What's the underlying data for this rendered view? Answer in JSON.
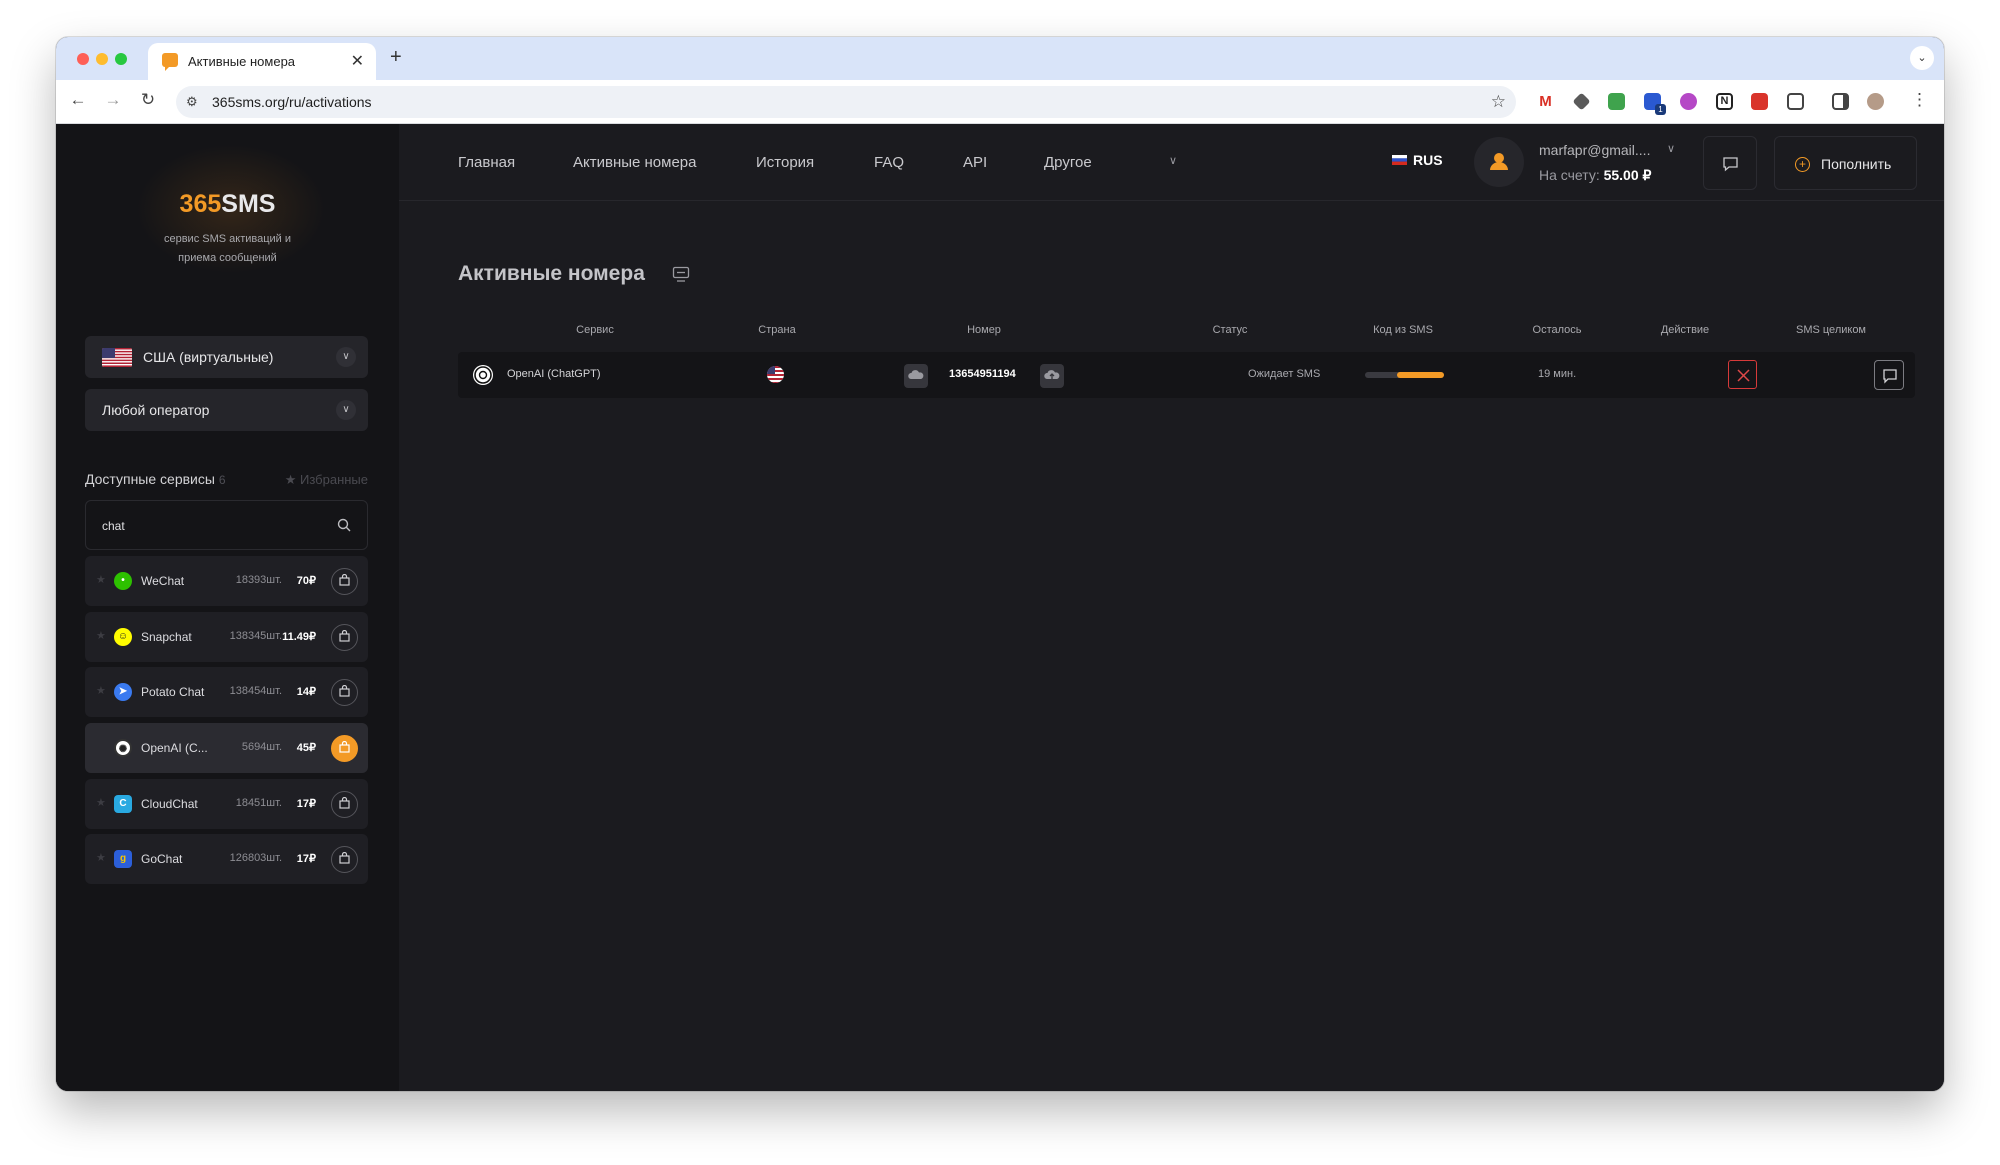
{
  "browser": {
    "tab_title": "Активные номера",
    "url": "365sms.org/ru/activations",
    "extension_badge": "1"
  },
  "sidebar": {
    "logo_number": "365",
    "logo_text": "SMS",
    "tagline": "сервис SMS активаций и приема сообщений",
    "country": "США (виртуальные)",
    "operator": "Любой оператор",
    "services_title": "Доступные сервисы",
    "services_count": "6",
    "favorites_label": "★ Избранные",
    "search_value": "chat",
    "services": [
      {
        "name": "WeChat",
        "qty": "18393шт.",
        "price": "70₽",
        "icon": "wechat-icon",
        "color": "#2dc100",
        "active": false
      },
      {
        "name": "Snapchat",
        "qty": "138345шт.",
        "price": "11.49₽",
        "icon": "snapchat-icon",
        "color": "#fffc00",
        "active": false
      },
      {
        "name": "Potato Chat",
        "qty": "138454шт.",
        "price": "14₽",
        "icon": "potato-chat-icon",
        "color": "#3a7af0",
        "active": false
      },
      {
        "name": "OpenAI (C...",
        "qty": "5694шт.",
        "price": "45₽",
        "icon": "openai-icon",
        "color": "#ffffff",
        "active": true
      },
      {
        "name": "CloudChat",
        "qty": "18451шт.",
        "price": "17₽",
        "icon": "cloudchat-icon",
        "color": "#29a9e1",
        "active": false
      },
      {
        "name": "GoChat",
        "qty": "126803шт.",
        "price": "17₽",
        "icon": "gochat-icon",
        "color": "#2c5fd9",
        "active": false
      }
    ]
  },
  "header": {
    "nav": [
      "Главная",
      "Активные номера",
      "История",
      "FAQ",
      "API",
      "Другое"
    ],
    "language": "RUS",
    "email": "marfapr@gmail....",
    "balance_label": "На счету:",
    "balance_value": "55.00 ₽",
    "topup_label": "Пополнить"
  },
  "main": {
    "page_title": "Активные номера",
    "columns": [
      "Сервис",
      "Страна",
      "Номер",
      "Статус",
      "Код из SMS",
      "Осталось",
      "Действие",
      "SMS целиком"
    ],
    "rows": [
      {
        "service": "OpenAI (ChatGPT)",
        "number": "13654951194",
        "status": "Ожидает SMS",
        "remaining": "19 мин.",
        "progress": 0.6
      }
    ]
  },
  "colors": {
    "accent": "#f39a26",
    "danger": "#d73a3a",
    "background": "#1b1b1f",
    "sidebar": "#141417"
  }
}
